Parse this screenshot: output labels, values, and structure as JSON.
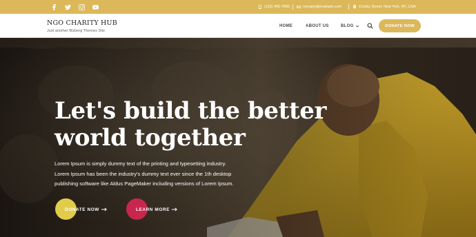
{
  "topbar": {
    "social": [
      "facebook-icon",
      "twitter-icon",
      "instagram-icon",
      "youtube-icon"
    ],
    "phone": "(123) 456-7890",
    "email": "nonsply@example.com",
    "address": "Crosby Street, New York, NY, USA"
  },
  "header": {
    "site_title": "NGO CHARITY HUB",
    "tagline": "Just another Bizberg Themes Site",
    "nav": [
      "HOME",
      "ABOUT US",
      "BLOG"
    ],
    "donate_label": "DONATE NOW"
  },
  "hero": {
    "title_line1": "Let's build the better",
    "title_line2": "world together",
    "text_line1": "Lorem Ipsum is simply dummy text of the printing and typesetting industry.",
    "text_line2": "Lorem Ipsum has been the industry's dummy text ever since the 1th desktop",
    "text_line3": "publishing software like Aldus PageMaker including versions of Lorem Ipsum.",
    "donate_button": "DONATE NOW",
    "learn_button": "LEARN MORE"
  },
  "colors": {
    "accent": "#dcb85a",
    "donate_circle": "#e0cc4a",
    "learn_circle": "#c9264e"
  }
}
